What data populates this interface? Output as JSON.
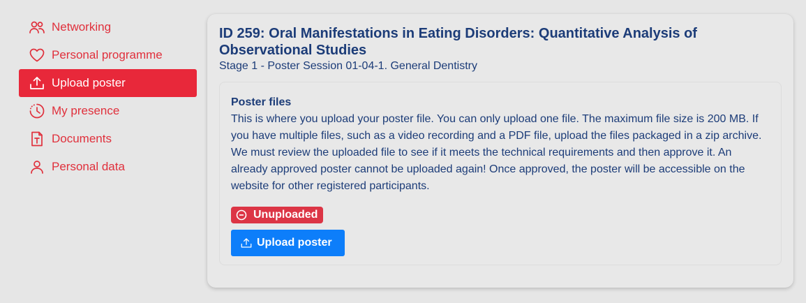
{
  "sidebar": {
    "items": [
      {
        "label": "Networking",
        "icon": "people-icon",
        "active": false
      },
      {
        "label": "Personal programme",
        "icon": "heart-icon",
        "active": false
      },
      {
        "label": "Upload poster",
        "icon": "upload-icon",
        "active": true
      },
      {
        "label": "My presence",
        "icon": "clock-icon",
        "active": false
      },
      {
        "label": "Documents",
        "icon": "document-icon",
        "active": false
      },
      {
        "label": "Personal data",
        "icon": "person-icon",
        "active": false
      }
    ]
  },
  "poster": {
    "title": "ID 259: Oral Manifestations in Eating Disorders: Quantitative Analysis of Observational Studies",
    "subtitle": "Stage 1 - Poster Session 01-04-1. General Dentistry"
  },
  "files": {
    "title": "Poster files",
    "description": "This is where you upload your poster file. You can only upload one file. The maximum file size is 200 MB. If you have multiple files, such as a video recording and a PDF file, upload the files packaged in a zip archive. We must review the uploaded file to see if it meets the technical requirements and then approve it. An already approved poster cannot be uploaded again! Once approved, the poster will be accessible on the website for other registered participants.",
    "status_label": "Unuploaded",
    "upload_label": "Upload poster"
  },
  "colors": {
    "accent_red": "#e8283a",
    "badge_red": "#dc3545",
    "primary_blue": "#0d7efa",
    "heading_navy": "#1c3c78"
  }
}
